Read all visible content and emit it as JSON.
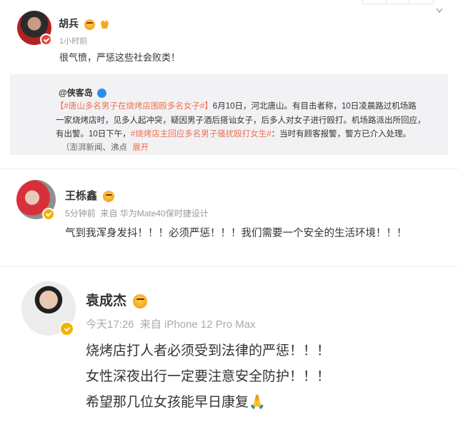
{
  "post1": {
    "author": "胡兵",
    "time": "1小时前",
    "text": "很气愤，严惩这些社会败类！",
    "repost": {
      "author": "@侠客岛",
      "line1_tag": "【#唐山多名男子在烧烤店围殴多名女子#】",
      "line1_rest": "6月10日，河北唐山。有目击者称，10日凌晨路过机场路",
      "line2": "一家烧烤店时，见多人起冲突，疑因男子酒后搭讪女子，后多人对女子进行殴打。机场路派出所回应，",
      "line3_a": "有出警。10日下午，",
      "line3_tag": "#烧烤店主回应多名男子骚扰殴打女生#",
      "line3_b": "：当时有顾客报警，警方已介入处理。",
      "line4": "（澎湃新闻、沸点",
      "expand": "展开"
    }
  },
  "post2": {
    "author": "王栎鑫",
    "time": "5分钟前",
    "source": "来自 华为Mate40保时捷设计",
    "text": "气到我浑身发抖！！！必须严惩！！！我们需要一个安全的生活环境！！！"
  },
  "post3": {
    "author": "袁成杰",
    "time": "今天17:26",
    "source": "来自 iPhone 12 Pro Max",
    "lines": [
      "烧烤店打人者必须受到法律的严惩！！！",
      "女性深夜出行一定要注意安全防护！！！",
      "希望那几位女孩能早日康复🙏"
    ]
  },
  "colors": {
    "tag": "#eb7350",
    "verified_gold": "#f0b400",
    "verified_red": "#e8453c",
    "meta": "#999999"
  },
  "icons": [
    "angry-emoji-icon",
    "verified-badge-icon",
    "chevron-down-icon",
    "pray-hands-icon"
  ]
}
